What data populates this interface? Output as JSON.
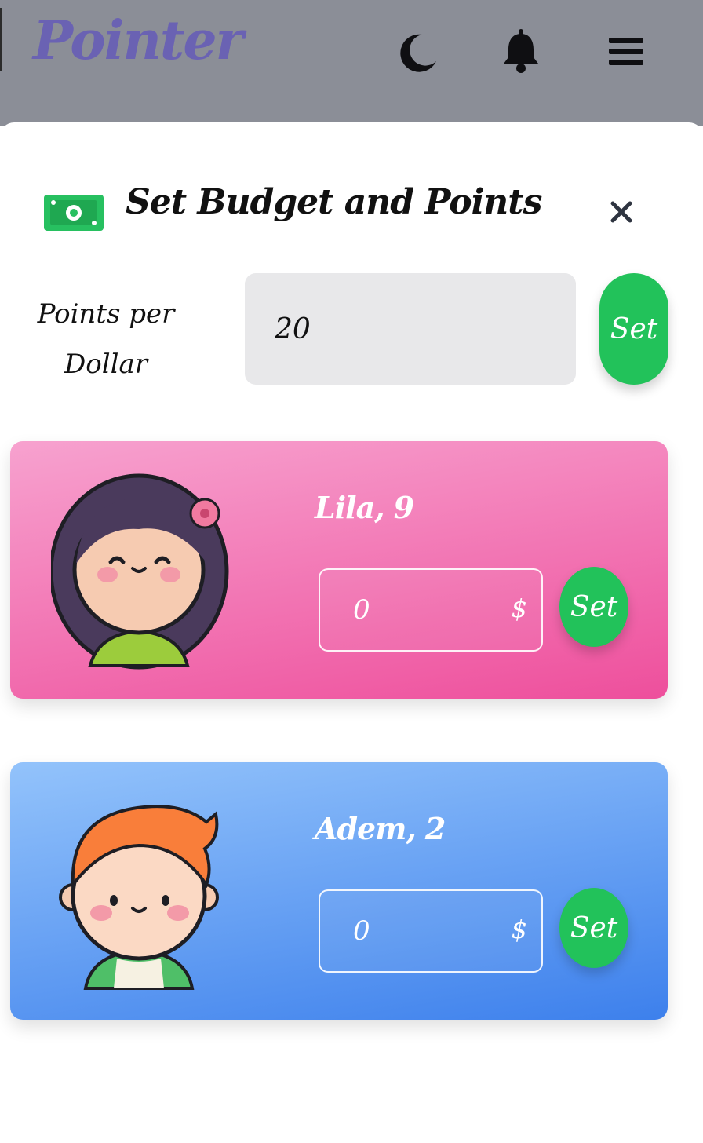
{
  "header": {
    "logo": "Pointer",
    "icons": [
      "moon-icon",
      "bell-icon",
      "menu-icon"
    ]
  },
  "modal": {
    "title": "Set Budget and Points",
    "title_icon": "money-bill-icon",
    "close_icon": "close-icon",
    "points_per_dollar": {
      "label_line1": "Points per",
      "label_line2": "Dollar",
      "value": "20",
      "set_label": "Set"
    },
    "children": [
      {
        "name": "Lila, 9",
        "amount": "0",
        "currency": "$",
        "set_label": "Set",
        "avatar": "girl-avatar"
      },
      {
        "name": "Adem, 2",
        "amount": "0",
        "currency": "$",
        "set_label": "Set",
        "avatar": "boy-avatar"
      }
    ]
  },
  "colors": {
    "topbar": "#8b8e97",
    "logo": "#6a62b3",
    "green": "#22c25a",
    "pink_card": "#ee4f9c",
    "blue_card": "#3d80ec",
    "input_bg": "#e8e8ea"
  }
}
